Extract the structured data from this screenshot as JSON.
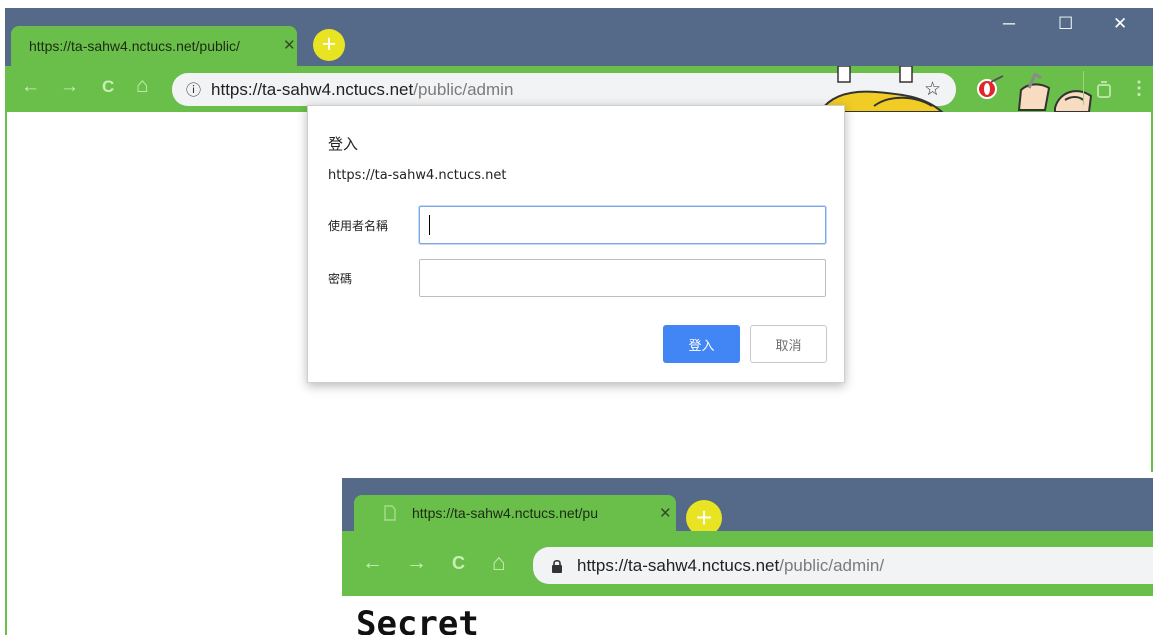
{
  "browser_back": {
    "tab": {
      "title": "https://ta-sahw4.nctucs.net/public/",
      "close_glyph": "✕"
    },
    "new_tab_glyph": "+",
    "window_controls": {
      "minimize": "─",
      "maximize": "☐",
      "close": "✕"
    },
    "nav": {
      "back": "←",
      "forward": "→",
      "reload": "C",
      "home": "⌂"
    },
    "omnibox": {
      "info_glyph": "ⓘ",
      "host": "https://ta-sahw4.nctucs.net",
      "path": "/public/admin",
      "bookmark_glyph": "☆"
    },
    "extensions": {
      "opera_icon": "opera-icon",
      "menu_glyph": "⋮"
    }
  },
  "auth_dialog": {
    "title": "登入",
    "origin": "https://ta-sahw4.nctucs.net",
    "username_label": "使用者名稱",
    "username_value": "",
    "password_label": "密碼",
    "password_value": "",
    "login_button": "登入",
    "cancel_button": "取消"
  },
  "browser_front": {
    "tab": {
      "title": "https://ta-sahw4.nctucs.net/pu",
      "close_glyph": "✕"
    },
    "new_tab_glyph": "+",
    "nav": {
      "back": "←",
      "forward": "→",
      "reload": "C",
      "home": "⌂"
    },
    "omnibox": {
      "lock_icon": "lock-icon",
      "host": "https://ta-sahw4.nctucs.net",
      "path": "/public/admin/"
    },
    "page_heading": "Secret"
  },
  "colors": {
    "chrome_titlebar": "#546a88",
    "chrome_toolbar": "#6abf4b",
    "new_tab": "#e9e423",
    "primary_button": "#4285f4"
  }
}
